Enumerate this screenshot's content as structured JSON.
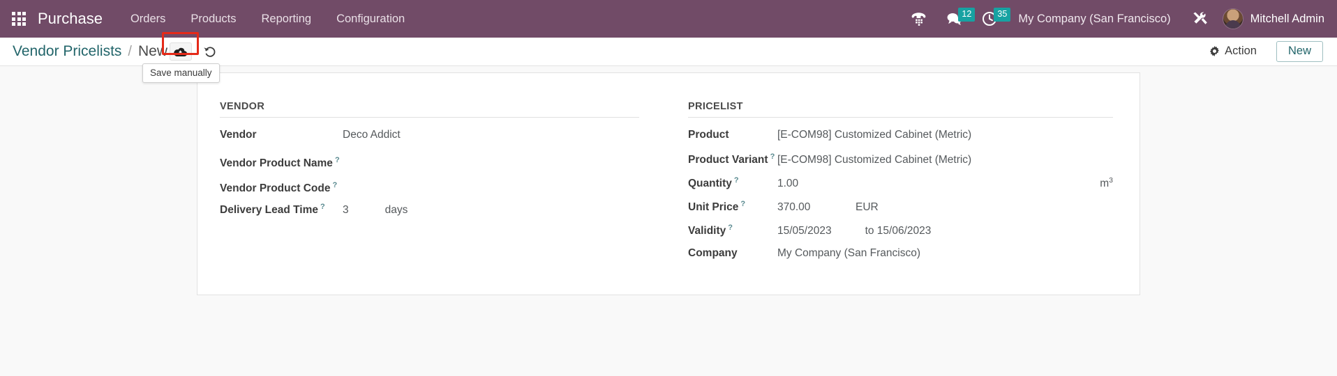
{
  "navbar": {
    "apps_icon": "apps-grid-icon",
    "brand": "Purchase",
    "menu": [
      {
        "label": "Orders"
      },
      {
        "label": "Products"
      },
      {
        "label": "Reporting"
      },
      {
        "label": "Configuration"
      }
    ],
    "sys_icons": [
      {
        "name": "phone-dialpad-icon",
        "badge": ""
      },
      {
        "name": "messages-icon",
        "badge": "12"
      },
      {
        "name": "activities-clock-icon",
        "badge": "35"
      }
    ],
    "company": "My Company (San Francisco)",
    "tools_icon": "developer-tools-icon",
    "user": "Mitchell Admin",
    "colors": {
      "navbar_bg": "#714B67",
      "badge_bg": "#17a2a2"
    }
  },
  "control_bar": {
    "breadcrumb_root": "Vendor Pricelists",
    "breadcrumb_sep": "/",
    "breadcrumb_current": "New",
    "save_icon": "cloud-upload-icon",
    "discard_icon": "undo-arrow-icon",
    "tooltip": "Save manually",
    "action_label": "Action",
    "action_icon": "gear-icon",
    "new_label": "New",
    "highlight_color": "#e52a19"
  },
  "form": {
    "vendor_group": {
      "title": "VENDOR",
      "fields": [
        {
          "label": "Vendor",
          "help": false,
          "value": "Deco Addict",
          "suffix": ""
        },
        {
          "label": "Vendor Product Name",
          "help": true,
          "value": "",
          "suffix": ""
        },
        {
          "label": "Vendor Product Code",
          "help": true,
          "value": "",
          "suffix": ""
        },
        {
          "label": "Delivery Lead Time",
          "help": true,
          "value": "3",
          "suffix": "days"
        }
      ]
    },
    "pricelist_group": {
      "title": "PRICELIST",
      "fields": [
        {
          "label": "Product",
          "help": false,
          "value": "[E-COM98] Customized Cabinet (Metric)"
        },
        {
          "label": "Product Variant",
          "help": true,
          "value": "[E-COM98] Customized Cabinet (Metric)"
        },
        {
          "label": "Quantity",
          "help": true,
          "value": "1.00",
          "uom": "m",
          "uom_sup": "3"
        },
        {
          "label": "Unit Price",
          "help": true,
          "value": "370.00",
          "currency": "EUR"
        },
        {
          "label": "Validity",
          "help": true,
          "value": "15/05/2023",
          "date_to": "to 15/06/2023"
        },
        {
          "label": "Company",
          "help": false,
          "value": "My Company (San Francisco)"
        }
      ]
    }
  }
}
